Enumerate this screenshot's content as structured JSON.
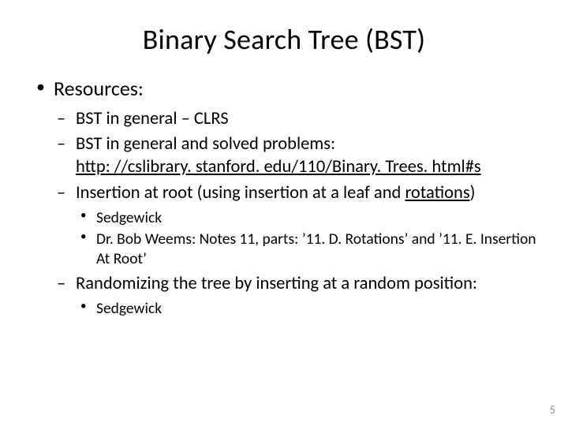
{
  "title": "Binary Search Tree (BST)",
  "l1_label": "Resources:",
  "l2": {
    "a": "BST in general – CLRS",
    "b": "BST in general and solved problems:",
    "b_link": "http: //cslibrary. stanford. edu/110/Binary. Trees. html#s",
    "c_pre": "Insertion at root (using insertion at a leaf and ",
    "c_u": "rotations",
    "c_post": ")",
    "d": "Randomizing the tree by inserting at a random position:"
  },
  "l3c": {
    "a": "Sedgewick",
    "b": "Dr. Bob Weems:  Notes 11, parts: ʼ11. D. Rotationsʼ and ʼ11. E. Insertion At Rootʼ"
  },
  "l3d": {
    "a": "Sedgewick"
  },
  "page": "5"
}
